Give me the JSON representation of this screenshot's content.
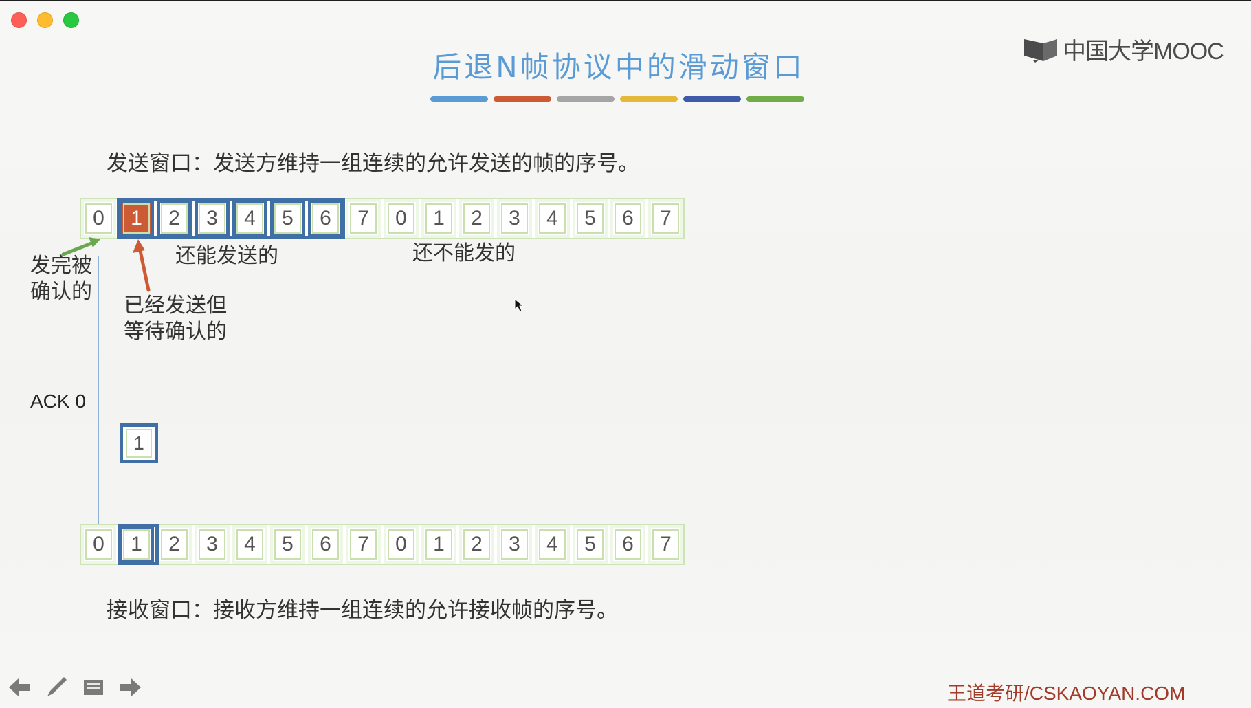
{
  "window": {
    "traffic_lights": [
      "close",
      "minimize",
      "zoom"
    ]
  },
  "slide": {
    "title": "后退N帧协议中的滑动窗口",
    "brand": "中国大学MOOC",
    "color_bars": [
      "#5b9bd5",
      "#cc5a35",
      "#a5a5a5",
      "#e6b83a",
      "#3e5aa9",
      "#70ad47"
    ],
    "send_window_text": "发送窗口：发送方维持一组连续的允许发送的帧的序号。",
    "recv_window_text": "接收窗口：接收方维持一组连续的允许接收帧的序号。",
    "send_sequence": [
      "0",
      "1",
      "2",
      "3",
      "4",
      "5",
      "6",
      "7",
      "0",
      "1",
      "2",
      "3",
      "4",
      "5",
      "6",
      "7"
    ],
    "recv_sequence": [
      "0",
      "1",
      "2",
      "3",
      "4",
      "5",
      "6",
      "7",
      "0",
      "1",
      "2",
      "3",
      "4",
      "5",
      "6",
      "7"
    ],
    "labels": {
      "can_send": "还能发送的",
      "cannot_send": "还不能发的",
      "acked_line1": "发完被",
      "acked_line2": "确认的",
      "waiting_line1": "已经发送但",
      "waiting_line2": "等待确认的"
    },
    "ack_text": "ACK  0",
    "packet_value": "1",
    "footer": "王道考研/CSKAOYAN.COM"
  },
  "toolbar": {
    "icons": [
      "arrow-left-icon",
      "pen-icon",
      "menu-icon",
      "arrow-right-icon"
    ]
  }
}
